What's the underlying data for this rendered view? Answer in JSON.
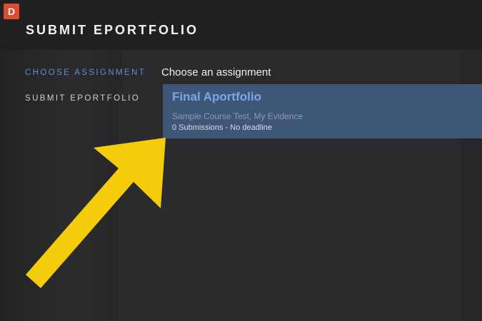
{
  "brand": {
    "badge_text": "D",
    "badge_color": "#e04a2f"
  },
  "header": {
    "title": "SUBMIT EPORTFOLIO"
  },
  "sidebar": {
    "items": [
      {
        "label": "CHOOSE ASSIGNMENT",
        "active": true
      },
      {
        "label": "SUBMIT EPORTFOLIO",
        "active": false
      }
    ]
  },
  "main": {
    "heading": "Choose an assignment",
    "assignments": [
      {
        "title": "Final Aportfolio",
        "course": "Sample Course Test, My Evidence",
        "meta": "0 Submissions - No deadline"
      }
    ]
  },
  "annotation": {
    "icon": "yellow-arrow-icon",
    "color": "#f5cc0a"
  },
  "colors": {
    "accent": "#5b8fd6",
    "card_bg": "#3e5677",
    "header_bg": "#202022"
  }
}
